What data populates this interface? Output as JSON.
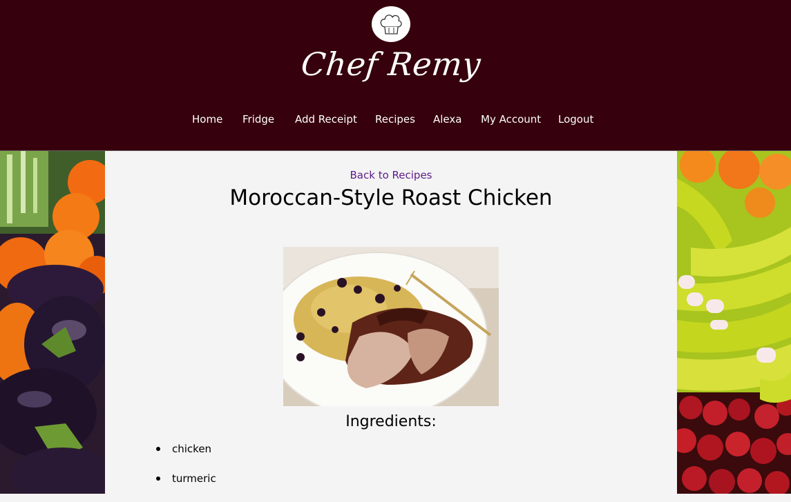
{
  "brand": {
    "name": "Chef Remy",
    "logo_icon": "chef-hat-icon"
  },
  "nav": {
    "items": [
      {
        "label": "Home"
      },
      {
        "label": "Fridge"
      },
      {
        "label": "Add Receipt"
      },
      {
        "label": "Recipes"
      },
      {
        "label": "Alexa"
      },
      {
        "label": "My Account"
      },
      {
        "label": "Logout"
      }
    ]
  },
  "recipe": {
    "back_label": "Back to Recipes",
    "title": "Moroccan-Style Roast Chicken",
    "ingredients_heading": "Ingredients:",
    "ingredients": [
      "chicken",
      "turmeric"
    ]
  },
  "colors": {
    "header_bg": "#36000c",
    "link": "#5b1a86",
    "content_bg": "#f4f4f4"
  }
}
